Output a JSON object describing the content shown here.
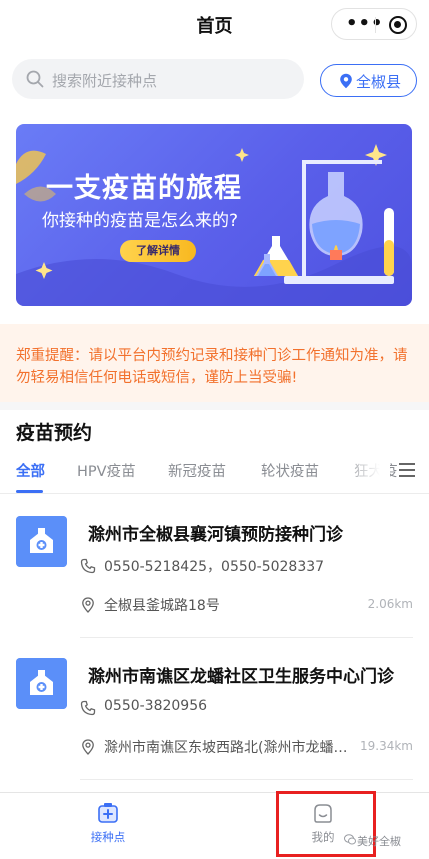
{
  "header": {
    "title": "首页"
  },
  "search": {
    "placeholder": "搜索附近接种点"
  },
  "location": {
    "label": "全椒县"
  },
  "banner": {
    "title": "一支疫苗的旅程",
    "subtitle": "你接种的疫苗是怎么来的?",
    "button_label": "了解详情"
  },
  "notice": {
    "text": "郑重提醒：请以平台内预约记录和接种门诊工作通知为准，请勿轻易相信任何电话或短信，谨防上当受骗!"
  },
  "section": {
    "title": "疫苗预约"
  },
  "tabs": [
    {
      "label": "全部",
      "active": true
    },
    {
      "label": "HPV疫苗",
      "active": false
    },
    {
      "label": "新冠疫苗",
      "active": false
    },
    {
      "label": "轮状疫苗",
      "active": false
    },
    {
      "label": "狂犬疫",
      "active": false
    }
  ],
  "clinics": [
    {
      "name": "滁州市全椒县襄河镇预防接种门诊",
      "phone": "0550-5218425，0550-5028337",
      "address": "全椒县釜城路18号",
      "distance": "2.06km"
    },
    {
      "name": "滁州市南谯区龙蟠社区卫生服务中心门诊",
      "phone": "0550-3820956",
      "address": "滁州市南谯区东坡西路北(滁州市龙蟠社区卫生服务中心)",
      "distance": "19.34km"
    }
  ],
  "tabbar": {
    "items": [
      {
        "label": "接种点",
        "icon": "vaccine-site-icon",
        "active": true
      },
      {
        "label": "我的",
        "icon": "profile-icon",
        "active": false
      }
    ]
  },
  "watermark": {
    "text": "美好全椒"
  },
  "colors": {
    "accent": "#3b6ff5",
    "notice_text": "#f2712d",
    "notice_bg": "#fff4ec",
    "banner_bg": "#5a5fea",
    "highlight": "#e82020"
  }
}
